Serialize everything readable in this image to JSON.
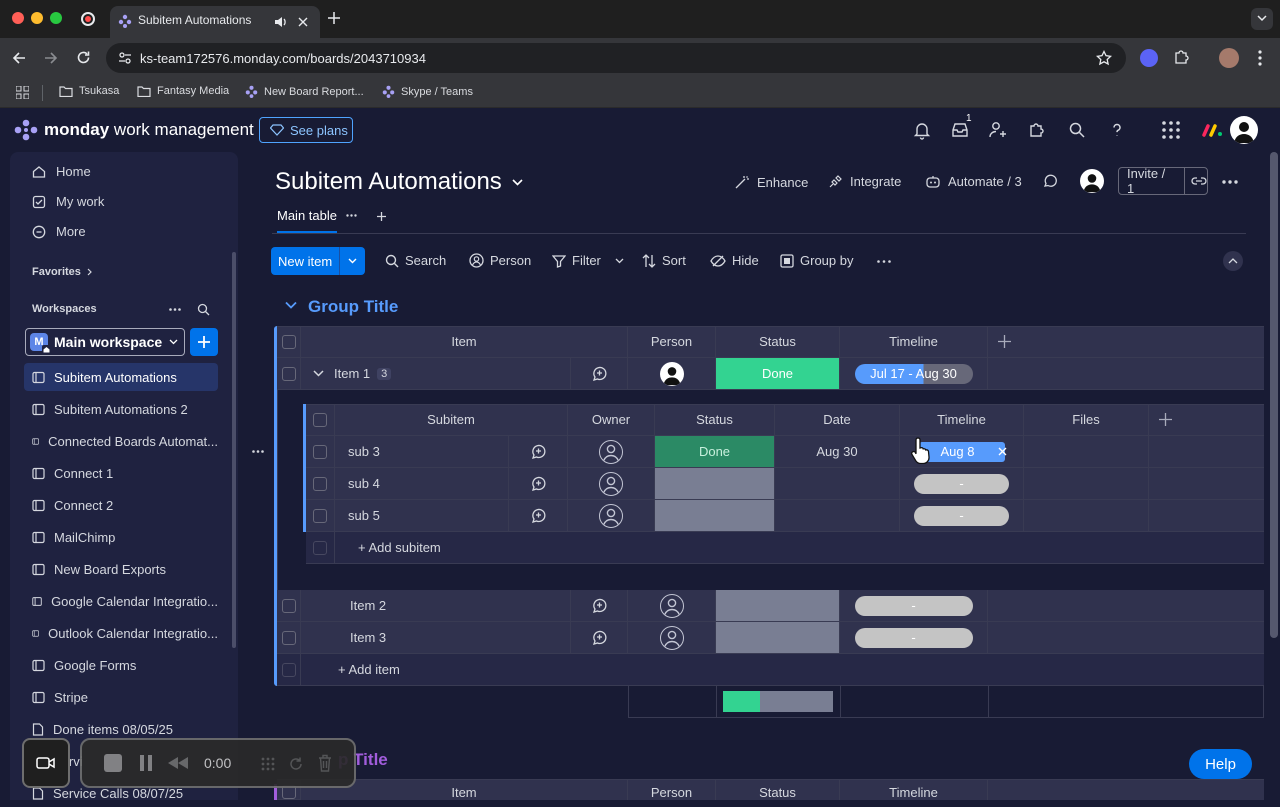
{
  "browser": {
    "tab_title": "Subitem Automations",
    "url": "ks-team172576.monday.com/boards/2043710934",
    "bookmarks": [
      "Tsukasa",
      "Fantasy Media",
      "New Board Report...",
      "Skype / Teams"
    ]
  },
  "app": {
    "brand_bold": "monday",
    "brand_rest": " work management",
    "see_plans": "See plans",
    "inbox_count": "1"
  },
  "sidebar": {
    "nav": [
      {
        "label": "Home",
        "icon": "home-icon"
      },
      {
        "label": "My work",
        "icon": "checkbox-icon"
      },
      {
        "label": "More",
        "icon": "more-circle-icon"
      }
    ],
    "favorites": "Favorites",
    "workspaces": "Workspaces",
    "workspace_badge": "M",
    "workspace_name": "Main workspace",
    "boards": [
      "Subitem Automations",
      "Subitem Automations 2",
      "Connected Boards Automat...",
      "Connect 1",
      "Connect 2",
      "MailChimp",
      "New Board Exports",
      "Google Calendar Integratio...",
      "Outlook Calendar Integratio...",
      "Google Forms",
      "Stripe",
      "Done items 08/05/25",
      "Servi",
      "Service Calls 08/07/25"
    ]
  },
  "board": {
    "title": "Subitem Automations",
    "actions": {
      "enhance": "Enhance",
      "integrate": "Integrate",
      "automate": "Automate / 3",
      "invite": "Invite / 1"
    },
    "view_tab": "Main table",
    "toolbar": {
      "new_item": "New item",
      "search": "Search",
      "person": "Person",
      "filter": "Filter",
      "sort": "Sort",
      "hide": "Hide",
      "group_by": "Group by"
    },
    "group_title": "Group Title",
    "group2_title": "p Title",
    "columns": [
      "Item",
      "Person",
      "Status",
      "Timeline"
    ],
    "items": [
      {
        "name": "Item 1",
        "subitem_count": "3",
        "status": "Done",
        "timeline": "Jul 17 - Aug 30"
      },
      {
        "name": "Item 2",
        "status": "",
        "timeline": "-"
      },
      {
        "name": "Item 3",
        "status": "",
        "timeline": "-"
      }
    ],
    "add_item": "+ Add item",
    "sub_columns": [
      "Subitem",
      "Owner",
      "Status",
      "Date",
      "Timeline",
      "Files"
    ],
    "subitems": [
      {
        "name": "sub 3",
        "status": "Done",
        "date": "Aug 30",
        "timeline": "Aug 8"
      },
      {
        "name": "sub 4",
        "status": "",
        "date": "",
        "timeline": "-"
      },
      {
        "name": "sub 5",
        "status": "",
        "date": "",
        "timeline": "-"
      }
    ],
    "add_subitem": "+ Add subitem",
    "status_summary": [
      {
        "color": "#33d391",
        "fraction": 0.333
      },
      {
        "color": "#797e93",
        "fraction": 0.667
      }
    ]
  },
  "recorder": {
    "time": "0:00"
  },
  "help": "Help",
  "colors": {
    "accent": "#0073ea",
    "done": "#33d391",
    "group": "#579bfc",
    "group2": "#a25ddc"
  }
}
